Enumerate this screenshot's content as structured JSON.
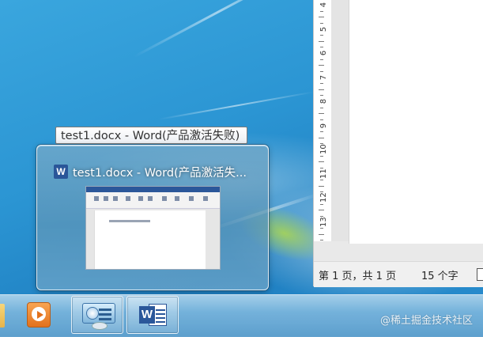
{
  "desktop": {
    "wallpaper": "windows-7-blue"
  },
  "word_window": {
    "ruler_numbers": [
      "4",
      "5",
      "6",
      "7",
      "8",
      "9",
      "10",
      "11",
      "12",
      "13"
    ],
    "status": {
      "page": "第 1 页，共 1 页",
      "word_count": "15 个字"
    }
  },
  "tooltip": {
    "text": "test1.docx - Word(产品激活失败)"
  },
  "preview": {
    "title": "test1.docx - Word(产品激活失...",
    "icon": "word-icon"
  },
  "taskbar": {
    "items": [
      {
        "name": "explorer",
        "icon": "folder-icon"
      },
      {
        "name": "media-player",
        "icon": "media-player-icon"
      },
      {
        "name": "control-panel",
        "icon": "control-panel-icon"
      },
      {
        "name": "word",
        "icon": "word-icon"
      }
    ]
  },
  "watermark": "@稀土掘金技术社区",
  "colors": {
    "accent": "#2b579a",
    "taskbar": "#6aa8d4",
    "desktop": "#2b95d3"
  }
}
